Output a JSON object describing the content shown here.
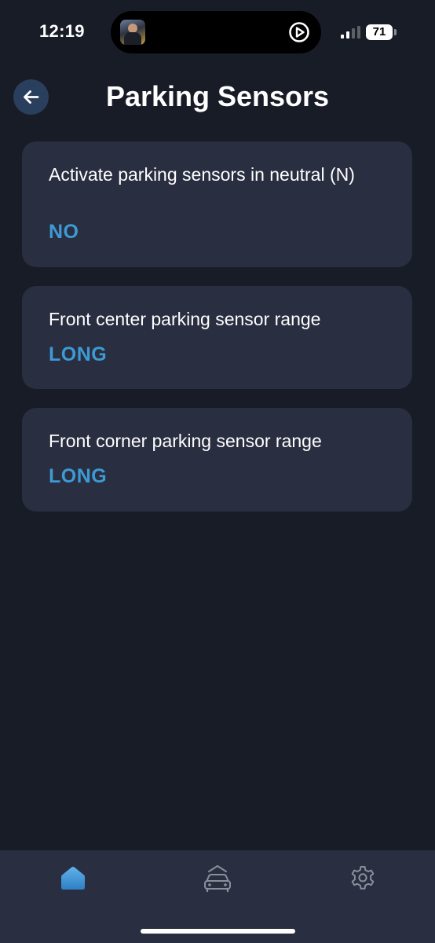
{
  "status_bar": {
    "time": "12:19",
    "battery": "71"
  },
  "header": {
    "title": "Parking Sensors",
    "back_icon": "arrow-left-icon"
  },
  "settings": [
    {
      "label": "Activate parking sensors in neutral (N)",
      "value": "NO"
    },
    {
      "label": "Front center parking sensor range",
      "value": "LONG"
    },
    {
      "label": "Front corner parking sensor range",
      "value": "LONG"
    }
  ],
  "tab_bar": {
    "tabs": [
      {
        "icon": "home-icon",
        "active": true
      },
      {
        "icon": "car-icon",
        "active": false
      },
      {
        "icon": "gear-icon",
        "active": false
      }
    ]
  },
  "colors": {
    "background": "#171c27",
    "card": "#292e40",
    "accent": "#3d9ad4",
    "back_button": "#2a3e5e"
  }
}
